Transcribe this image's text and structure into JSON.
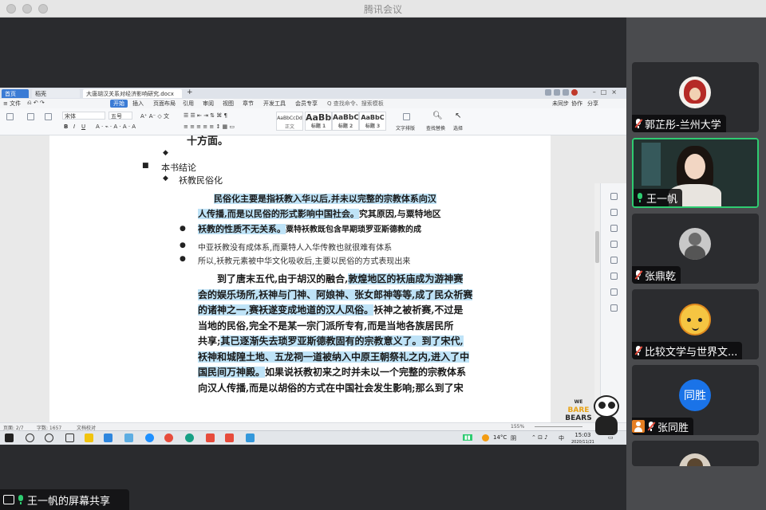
{
  "window_title": "腾讯会议",
  "wps": {
    "tabs": [
      "首页",
      "稻壳",
      "大唐胡汉关系对经济影响研究.docx"
    ],
    "menu": [
      "≡ 文件",
      "开始",
      "插入",
      "页面布局",
      "引用",
      "审阅",
      "视图",
      "章节",
      "开发工具",
      "会员专享",
      "Q 查找命令、搜索模板"
    ],
    "active_menu": "开始",
    "menu_right": [
      "未同步",
      "协作",
      "分享"
    ],
    "toolbar": {
      "font_name": "宋体",
      "font_size": "五号",
      "styles": [
        {
          "preview": "AaBbCcDd",
          "label": "正文"
        },
        {
          "preview": "AaBb",
          "label": "标题 1"
        },
        {
          "preview": "AaBbC",
          "label": "标题 2"
        },
        {
          "preview": "AaBbC",
          "label": "标题 3"
        }
      ],
      "right_tools": [
        "文字排版",
        "查找替换",
        "选择"
      ]
    },
    "document": {
      "top_heading": "十方面。",
      "outline": {
        "section": "本书结论",
        "subsection": "袄教民俗化"
      },
      "highlight_para": {
        "line1": "民俗化主要是指袄教入华以后,并未以完整的宗教体系向汉",
        "line2_hl": "人传播,而是以民俗的形式影响中国社会。",
        "line2_rest": "究其原因,与粟特地区",
        "line3_hl": "袄教的性质不无关系。",
        "line3_rest": "粟特袄教既包含早期琐罗亚斯德教的成"
      },
      "bullets": [
        "中亚袄教没有成体系,而粟特人入华传教也就很难有体系",
        "所以,袄教元素被中华文化吸收后,主要以民俗的方式表现出来"
      ],
      "main_para": [
        {
          "segments": [
            {
              "t": "到了唐末五代,由于胡汉的融合,",
              "hl": false
            },
            {
              "t": "敦煌地区的袄庙成为游神赛",
              "hl": true
            }
          ]
        },
        {
          "segments": [
            {
              "t": "会的娱乐场所,袄神与门神、阿娘神、张女郎神等等,成了民众祈赛",
              "hl": true
            }
          ]
        },
        {
          "segments": [
            {
              "t": "的诸神之一,赛袄遂变成地道的汉人风俗。",
              "hl": true
            },
            {
              "t": "袄神之被祈赛,不过是",
              "hl": false
            }
          ]
        },
        {
          "segments": [
            {
              "t": "当地的民俗,完全不是某一宗门派所专有,而是当地各族居民所",
              "hl": false
            }
          ]
        },
        {
          "segments": [
            {
              "t": "共享;",
              "hl": false
            },
            {
              "t": "其已逐渐失去琐罗亚斯德教固有的宗教意义了。",
              "hl": true
            },
            {
              "t": "到了宋代,",
              "hl": true
            }
          ]
        },
        {
          "segments": [
            {
              "t": "袄神和城隍土地、五龙祠一道被纳入中原王朝祭礼之内,进入了中",
              "hl": true
            }
          ]
        },
        {
          "segments": [
            {
              "t": "国民间万神殿。",
              "hl": true
            },
            {
              "t": "如果说袄教初来之时并未以一个完整的宗教体系",
              "hl": false
            }
          ]
        },
        {
          "segments": [
            {
              "t": "向汉人传播,而是以胡俗的方式在中国社会发生影响;那么到了宋",
              "hl": false
            }
          ]
        }
      ]
    },
    "status": {
      "page": "页面: 2/7",
      "words": "字数: 1657",
      "check": "文档校对",
      "zoom": "155%"
    }
  },
  "taskbar": {
    "temp": "14°C",
    "weather": "阴",
    "ime": "中",
    "time": "15:03",
    "date": "2020/11/21"
  },
  "stickers": {
    "bare_text1": "WE",
    "bare_text2": "BARE",
    "bare_text3": "BEARS"
  },
  "share_label": "王一帆的屏幕共享",
  "participants": [
    {
      "name": "郭芷彤-兰州大学",
      "muted": true,
      "avatar": "photo"
    },
    {
      "name": "王一帆",
      "muted": false,
      "avatar": "video",
      "active": true
    },
    {
      "name": "张鼎乾",
      "muted": true,
      "avatar": "photo"
    },
    {
      "name": "比较文学与世界文...",
      "muted": true,
      "avatar": "cartoon"
    },
    {
      "name": "张同胜",
      "muted": true,
      "avatar": "text",
      "avatar_text": "同胜"
    }
  ],
  "colors": {
    "highlight": "#bfe3f7",
    "active_border": "#2ecc71",
    "avatar_blue": "#1a73e8",
    "wps_blue": "#3a7bd5"
  }
}
